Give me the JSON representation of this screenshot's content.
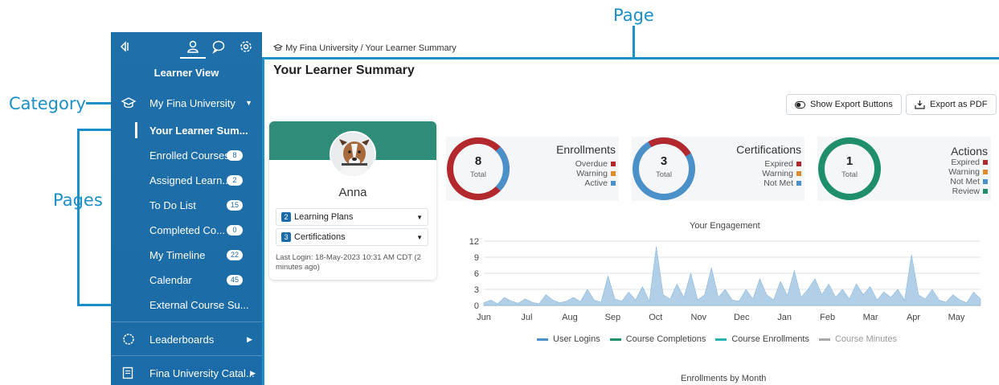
{
  "annotations": {
    "page": "Page",
    "category": "Category",
    "pages": "Pages"
  },
  "sidebar": {
    "view_title": "Learner View",
    "category": "My Fina University",
    "pages": [
      {
        "label": "Your Learner Sum...",
        "badge": null
      },
      {
        "label": "Enrolled Courses",
        "badge": "8"
      },
      {
        "label": "Assigned Learn...",
        "badge": "2"
      },
      {
        "label": "To Do List",
        "badge": "15"
      },
      {
        "label": "Completed Co...",
        "badge": "0"
      },
      {
        "label": "My Timeline",
        "badge": "22"
      },
      {
        "label": "Calendar",
        "badge": "45"
      },
      {
        "label": "External Course Su...",
        "badge": null
      }
    ],
    "leaderboards": "Leaderboards",
    "catalog": "Fina University Catal..."
  },
  "breadcrumb": "My Fina University / Your Learner Summary",
  "page_title": "Your Learner Summary",
  "buttons": {
    "show_export": "Show Export Buttons",
    "export_pdf": "Export as PDF"
  },
  "profile": {
    "name": "Anna",
    "learning_plans_count": "2",
    "learning_plans": "Learning Plans",
    "certifications_count": "3",
    "certifications": "Certifications",
    "last_login": "Last Login: 18-May-2023 10:31 AM CDT (2 minutes ago)"
  },
  "stats": {
    "enrollments": {
      "title": "Enrollments",
      "total": "8",
      "total_label": "Total",
      "legend": [
        "Overdue",
        "Warning",
        "Active"
      ]
    },
    "certifications": {
      "title": "Certifications",
      "total": "3",
      "total_label": "Total",
      "legend": [
        "Expired",
        "Warning",
        "Not Met"
      ]
    },
    "actions": {
      "title": "Actions",
      "total": "1",
      "total_label": "Total",
      "legend": [
        "Expired",
        "Warning",
        "Not Met",
        "Review"
      ]
    }
  },
  "colors": {
    "red": "#b3282d",
    "orange": "#e08a2c",
    "blue": "#4a90c9",
    "green": "#1e8f6a",
    "accent": "#1a8fc9"
  },
  "engagement_title": "Your Engagement",
  "bottom_title": "Enrollments by Month",
  "chart_data": {
    "type": "area",
    "title": "Your Engagement",
    "categories": [
      "Jun",
      "Jul",
      "Aug",
      "Sep",
      "Oct",
      "Nov",
      "Dec",
      "Jan",
      "Feb",
      "Mar",
      "Apr",
      "May"
    ],
    "y_ticks": [
      "0",
      "3",
      "6",
      "9",
      "12"
    ],
    "ylim": [
      0,
      12
    ],
    "series": [
      {
        "name": "User Logins",
        "values": [
          0.5,
          1,
          0.3,
          1.5,
          0.8,
          0.4,
          1.2,
          0.6,
          0.3,
          2,
          1,
          0.5,
          0.8,
          1.5,
          0.7,
          3,
          1,
          0.6,
          5.5,
          1.2,
          0.8,
          2.5,
          1,
          3.5,
          0.8,
          11,
          2,
          1.2,
          4,
          1.5,
          6,
          1,
          2,
          7,
          1.5,
          3,
          1,
          0.8,
          3,
          1.2,
          5,
          2,
          1,
          4.5,
          1.8,
          6.5,
          1.5,
          3,
          5,
          2,
          4,
          1.5,
          3,
          1.2,
          4,
          2,
          3.5,
          1,
          2.5,
          1.5,
          3,
          1,
          9.5,
          2,
          1.2,
          3,
          1,
          0.6,
          2,
          1,
          0.5,
          2.5,
          1.2
        ]
      },
      {
        "name": "Course Completions",
        "values": []
      },
      {
        "name": "Course Enrollments",
        "values": []
      },
      {
        "name": "Course Minutes",
        "values": []
      }
    ],
    "legend_colors": [
      "#4a90c9",
      "#1e8f6a",
      "#2bb3b0",
      "#a9a9a9"
    ]
  }
}
